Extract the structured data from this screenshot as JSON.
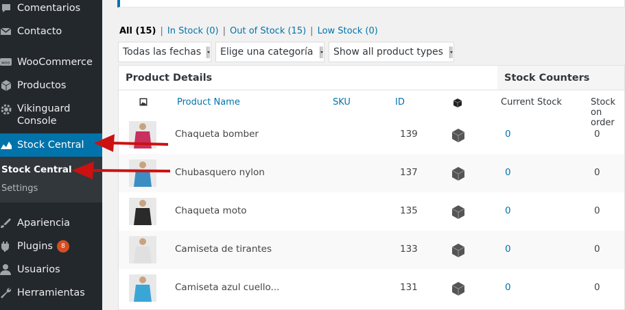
{
  "sidebar": {
    "items": [
      {
        "label": "Comentarios",
        "icon": "comment-icon"
      },
      {
        "label": "Contacto",
        "icon": "mail-icon"
      },
      {
        "label": "WooCommerce",
        "icon": "woocommerce-icon"
      },
      {
        "label": "Productos",
        "icon": "box-icon"
      },
      {
        "label": "Vikinguard Console",
        "icon": "gear-icon"
      },
      {
        "label": "Stock Central",
        "icon": "chart-icon"
      },
      {
        "label": "Apariencia",
        "icon": "paintbrush-icon"
      },
      {
        "label": "Plugins",
        "icon": "plugin-icon",
        "badge": "8"
      },
      {
        "label": "Usuarios",
        "icon": "user-icon"
      },
      {
        "label": "Herramientas",
        "icon": "wrench-icon"
      }
    ],
    "submenu": {
      "current": "Stock Central",
      "settings": "Settings"
    }
  },
  "filters": {
    "all": "All (15)",
    "in_stock": "In Stock (0)",
    "out_of_stock": "Out of Stock (15)",
    "low_stock": "Low Stock (0)",
    "separator": "|"
  },
  "dropdowns": {
    "dates": "Todas las fechas",
    "category": "Elige una categoría",
    "types": "Show all product types"
  },
  "table": {
    "group_product": "Product Details",
    "group_stock": "Stock Counters",
    "columns": {
      "name": "Product Name",
      "sku": "SKU",
      "id": "ID",
      "current": "Current Stock",
      "order": "Stock on order"
    },
    "rows": [
      {
        "name": "Chaqueta bomber",
        "id": "139",
        "current": "0",
        "order": "0",
        "color": "#c83060"
      },
      {
        "name": "Chubasquero nylon",
        "id": "137",
        "current": "0",
        "order": "0",
        "color": "#3b8ec4"
      },
      {
        "name": "Chaqueta moto",
        "id": "135",
        "current": "0",
        "order": "0",
        "color": "#2a2a2a"
      },
      {
        "name": "Camiseta de tirantes",
        "id": "133",
        "current": "0",
        "order": "0",
        "color": "#e0e0e0"
      },
      {
        "name": "Camiseta azul cuello...",
        "id": "131",
        "current": "0",
        "order": "0",
        "color": "#3aa6d8"
      }
    ]
  },
  "colors": {
    "accent": "#0073aa",
    "sidebar": "#23282d",
    "arrow": "#cc1111",
    "badge": "#d54e21"
  }
}
